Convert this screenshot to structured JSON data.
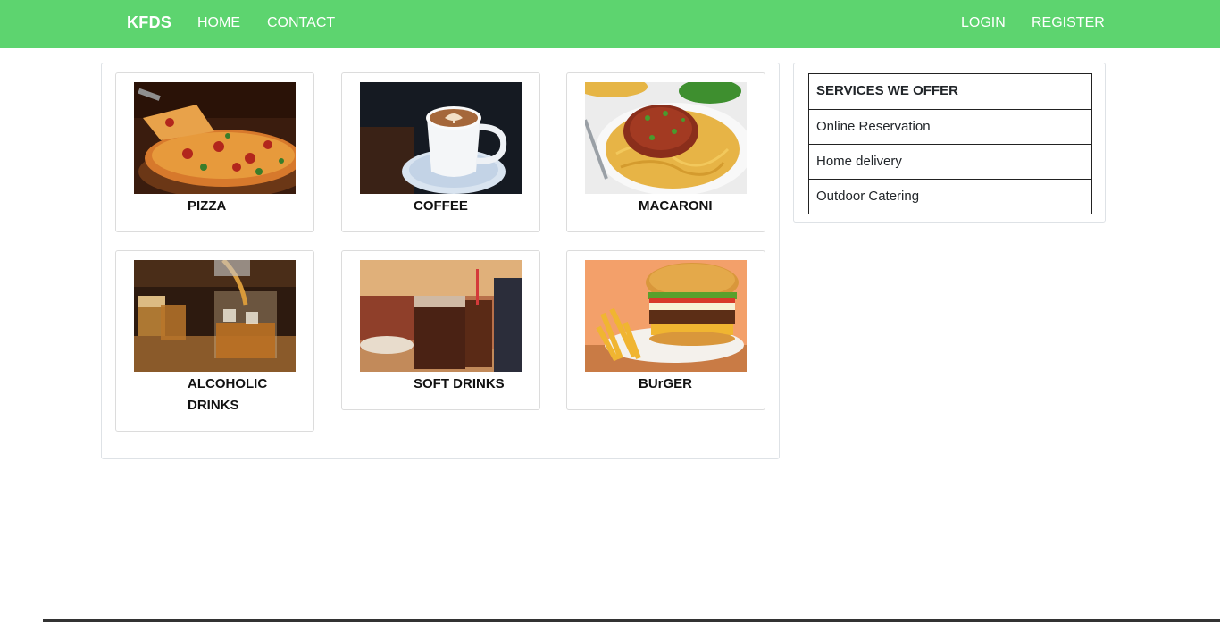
{
  "navbar": {
    "brand": "KFDS",
    "links_left": [
      "HOME",
      "CONTACT"
    ],
    "links_right": [
      "LOGIN",
      "REGISTER"
    ],
    "color": "#5dd46f"
  },
  "menu": {
    "items": [
      {
        "label": "PIZZA",
        "image": "pizza-photo"
      },
      {
        "label": "COFFEE",
        "image": "coffee-photo"
      },
      {
        "label": "MACARONI",
        "image": "macaroni-photo"
      },
      {
        "label": "ALCOHOLIC DRINKS",
        "image": "whiskey-photo"
      },
      {
        "label": "SOFT DRINKS",
        "image": "cola-photo"
      },
      {
        "label": "BUrGER",
        "image": "burger-photo"
      }
    ]
  },
  "services": {
    "heading": "SERVICES WE OFFER",
    "items": [
      "Online Reservation",
      "Home delivery",
      "Outdoor Catering"
    ]
  }
}
